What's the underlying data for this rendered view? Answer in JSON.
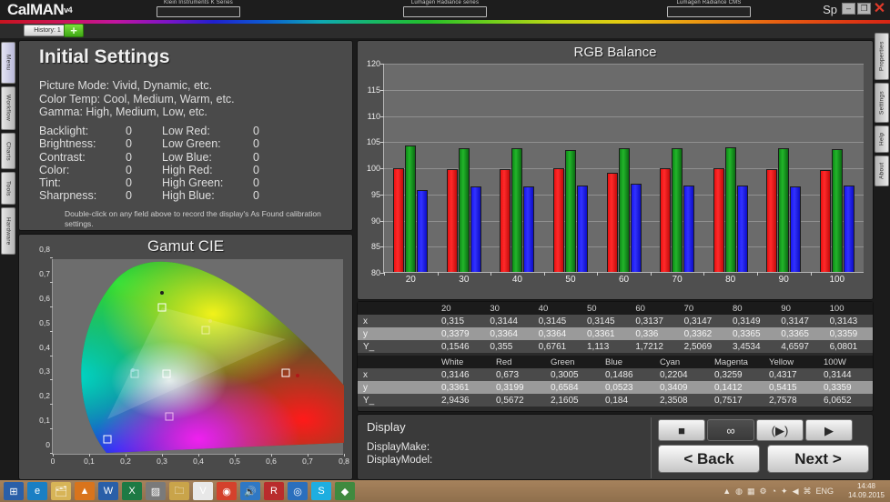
{
  "titlebar": {
    "logo": "CalMAN",
    "logo_version": "v4",
    "meter1": "Klein Instruments K Series",
    "meter2": "Lumagen Radiance series",
    "meter3": "Lumagen Radiance CMS",
    "sp_label": "Sp",
    "minimize": "–",
    "maximize": "❐",
    "close": "✕"
  },
  "history": {
    "label": "History: 1",
    "add_label": "+"
  },
  "left_tabs": [
    {
      "label": "Menu",
      "selected": true
    },
    {
      "label": "Workflow",
      "selected": false
    },
    {
      "label": "Charts",
      "selected": false
    },
    {
      "label": "Tools",
      "selected": false
    },
    {
      "label": "Hardware",
      "selected": false
    }
  ],
  "right_tabs": [
    {
      "label": "Properties"
    },
    {
      "label": "Settings"
    },
    {
      "label": "Help"
    },
    {
      "label": "About"
    }
  ],
  "initial_settings": {
    "title": "Initial Settings",
    "modes": [
      "Picture Mode:  Vivid, Dynamic, etc.",
      "Color Temp:  Cool, Medium, Warm, etc.",
      "Gamma:  High, Medium, Low, etc."
    ],
    "fields": [
      {
        "label": "Backlight:",
        "value": "0",
        "label2": "Low Red:",
        "value2": "0"
      },
      {
        "label": "Brightness:",
        "value": "0",
        "label2": "Low Green:",
        "value2": "0"
      },
      {
        "label": "Contrast:",
        "value": "0",
        "label2": "Low Blue:",
        "value2": "0"
      },
      {
        "label": "Color:",
        "value": "0",
        "label2": "High Red:",
        "value2": "0"
      },
      {
        "label": "Tint:",
        "value": "0",
        "label2": "High Green:",
        "value2": "0"
      },
      {
        "label": "Sharpness:",
        "value": "0",
        "label2": "High Blue:",
        "value2": "0"
      }
    ],
    "note": "Double-click on any field above to record the display's As Found calibration settings."
  },
  "gamut": {
    "title": "Gamut CIE",
    "x_ticks": [
      "0",
      "0,1",
      "0,2",
      "0,3",
      "0,4",
      "0,5",
      "0,6",
      "0,7",
      "0,8"
    ],
    "y_ticks": [
      "0",
      "0,1",
      "0,2",
      "0,3",
      "0,4",
      "0,5",
      "0,6",
      "0,7",
      "0,8"
    ],
    "markers": [
      {
        "name": "green-target",
        "x": 0.3,
        "y": 0.6,
        "color": "#ffffff"
      },
      {
        "name": "green-measured",
        "x": 0.3005,
        "y": 0.6584,
        "color": "#202020"
      },
      {
        "name": "yellow-target",
        "x": 0.419,
        "y": 0.505,
        "color": "#f0f0a0"
      },
      {
        "name": "yellow-measured",
        "x": 0.4317,
        "y": 0.5415,
        "color": "#e8e860"
      },
      {
        "name": "cyan-target",
        "x": 0.225,
        "y": 0.329,
        "color": "#bfe8e8"
      },
      {
        "name": "cyan-measured",
        "x": 0.2204,
        "y": 0.3409,
        "color": "#9fe0e0"
      },
      {
        "name": "white-target",
        "x": 0.3127,
        "y": 0.329,
        "color": "#ffffff"
      },
      {
        "name": "red-target",
        "x": 0.64,
        "y": 0.33,
        "color": "#ffffff"
      },
      {
        "name": "red-measured",
        "x": 0.673,
        "y": 0.3199,
        "color": "#b01818"
      },
      {
        "name": "magenta-target",
        "x": 0.321,
        "y": 0.154,
        "color": "#f0b8f0"
      },
      {
        "name": "blue-target",
        "x": 0.15,
        "y": 0.06,
        "color": "#ffffff"
      }
    ]
  },
  "chart_data": {
    "type": "bar",
    "title": "RGB Balance",
    "xlabel": "",
    "ylabel": "",
    "ylim": [
      80,
      120
    ],
    "y_ticks": [
      80,
      85,
      90,
      95,
      100,
      105,
      110,
      115,
      120
    ],
    "grid": true,
    "legend": "none",
    "categories": [
      "20",
      "30",
      "40",
      "50",
      "60",
      "70",
      "80",
      "90",
      "100"
    ],
    "series": [
      {
        "name": "Red",
        "color": "#ff2a2a",
        "values": [
          99.8,
          99.6,
          99.6,
          99.8,
          99.0,
          99.9,
          99.8,
          99.6,
          99.5
        ]
      },
      {
        "name": "Green",
        "color": "#22b52a",
        "values": [
          104.2,
          103.7,
          103.6,
          103.3,
          103.6,
          103.7,
          103.8,
          103.7,
          103.4
        ]
      },
      {
        "name": "Blue",
        "color": "#3232ff",
        "values": [
          95.6,
          96.4,
          96.4,
          96.5,
          96.8,
          96.6,
          96.5,
          96.3,
          96.6
        ]
      }
    ]
  },
  "table1": {
    "headers": [
      "",
      "20",
      "30",
      "40",
      "50",
      "60",
      "70",
      "80",
      "90",
      "100"
    ],
    "rows": [
      [
        "x",
        "0,315",
        "0,3144",
        "0,3145",
        "0,3145",
        "0,3137",
        "0,3147",
        "0,3149",
        "0,3147",
        "0,3143"
      ],
      [
        "y",
        "0,3379",
        "0,3364",
        "0,3364",
        "0,3361",
        "0,336",
        "0,3362",
        "0,3365",
        "0,3365",
        "0,3359"
      ],
      [
        "Y_",
        "0,1546",
        "0,355",
        "0,6761",
        "1,113",
        "1,7212",
        "2,5069",
        "3,4534",
        "4,6597",
        "6,0801"
      ]
    ]
  },
  "table2": {
    "headers": [
      "",
      "White",
      "Red",
      "Green",
      "Blue",
      "Cyan",
      "Magenta",
      "Yellow",
      "100W"
    ],
    "rows": [
      [
        "x",
        "0,3146",
        "0,673",
        "0,3005",
        "0,1486",
        "0,2204",
        "0,3259",
        "0,4317",
        "0,3144"
      ],
      [
        "y",
        "0,3361",
        "0,3199",
        "0,6584",
        "0,0523",
        "0,3409",
        "0,1412",
        "0,5415",
        "0,3359"
      ],
      [
        "Y_",
        "2,9436",
        "0,5672",
        "2,1605",
        "0,184",
        "2,3508",
        "0,7517",
        "2,7578",
        "6,0652"
      ]
    ]
  },
  "bottom": {
    "display_title": "Display",
    "display_make_label": "DisplayMake:",
    "display_model_label": "DisplayModel:",
    "controls": [
      {
        "name": "stop-button",
        "glyph": "■"
      },
      {
        "name": "continuous-button",
        "glyph": "∞"
      },
      {
        "name": "play-loop-button",
        "glyph": "(▶)"
      },
      {
        "name": "play-button",
        "glyph": "▶"
      }
    ],
    "back_label": "< Back",
    "next_label": "Next >"
  },
  "taskbar": {
    "icons": [
      {
        "name": "start-button",
        "glyph": "⊞",
        "bg": "#2a5fa8"
      },
      {
        "name": "internet-explorer",
        "glyph": "e",
        "bg": "#1a7fc4"
      },
      {
        "name": "explorer-folder",
        "glyph": "🗂",
        "bg": "#d7b457"
      },
      {
        "name": "vlc-player",
        "glyph": "▲",
        "bg": "#d9741c"
      },
      {
        "name": "word-document",
        "glyph": "W",
        "bg": "#2a5fa8"
      },
      {
        "name": "excel-document",
        "glyph": "X",
        "bg": "#1d7a44"
      },
      {
        "name": "misc-app",
        "glyph": "▨",
        "bg": "#7a7a7a"
      },
      {
        "name": "folder-yellow",
        "glyph": "🗀",
        "bg": "#c9a44a"
      },
      {
        "name": "vnc-viewer",
        "glyph": "V",
        "bg": "#e8e8e8"
      },
      {
        "name": "chrome-browser",
        "glyph": "◉",
        "bg": "#d4412c"
      },
      {
        "name": "volume-app",
        "glyph": "🔊",
        "bg": "#2f78c4"
      },
      {
        "name": "rew-app",
        "glyph": "R",
        "bg": "#b92c2c"
      },
      {
        "name": "media-app",
        "glyph": "◎",
        "bg": "#2a6fbd"
      },
      {
        "name": "skype-app",
        "glyph": "S",
        "bg": "#1eaee0"
      },
      {
        "name": "calman-app",
        "glyph": "◆",
        "bg": "#3f8a3f"
      }
    ],
    "tray": [
      "▲",
      "◍",
      "▦",
      "⚙",
      "◔",
      "✦",
      "◀",
      "⌘"
    ],
    "language": "ENG",
    "time": "14:48",
    "date": "14.09.2015"
  }
}
